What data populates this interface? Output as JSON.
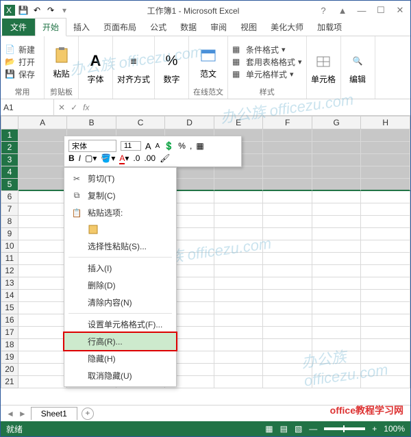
{
  "title": "工作簿1 - Microsoft Excel",
  "qat": {
    "save": "💾",
    "undo": "↶",
    "redo": "↷"
  },
  "winbtns": {
    "help": "?",
    "ribmin": "▲",
    "min": "—",
    "max": "☐",
    "close": "✕"
  },
  "tabs": {
    "file": "文件",
    "items": [
      "开始",
      "插入",
      "页面布局",
      "公式",
      "数据",
      "审阅",
      "视图",
      "美化大师",
      "加载项"
    ],
    "active_index": 0
  },
  "ribbon": {
    "group1": {
      "new": "新建",
      "open": "打开",
      "save": "保存",
      "label": "常用"
    },
    "clipboard": {
      "paste": "粘贴",
      "label": "剪贴板"
    },
    "font": {
      "btn": "字体",
      "label": ""
    },
    "align": {
      "btn": "对齐方式",
      "label": ""
    },
    "number": {
      "btn": "数字",
      "label": ""
    },
    "onlinefw": {
      "btn": "范文",
      "label": "在线范文"
    },
    "styles": {
      "cond": "条件格式",
      "tblfmt": "套用表格格式",
      "cellstyle": "单元格样式",
      "label": "样式"
    },
    "cells": {
      "btn": "单元格",
      "label": ""
    },
    "edit": {
      "btn": "编辑",
      "label": ""
    }
  },
  "namebox": "A1",
  "fx": "fx",
  "cols": [
    "A",
    "B",
    "C",
    "D",
    "E",
    "F",
    "G",
    "H"
  ],
  "rows": [
    "1",
    "2",
    "3",
    "4",
    "5",
    "6",
    "7",
    "8",
    "9",
    "10",
    "11",
    "12",
    "13",
    "14",
    "15",
    "16",
    "17",
    "18",
    "19",
    "20",
    "21"
  ],
  "minitb": {
    "font": "宋体",
    "size": "11",
    "bold": "B",
    "italic": "I",
    "inc": "A",
    "dec": "A",
    "curr": "%",
    "comma": ","
  },
  "context": [
    {
      "icon": "✂",
      "label": "剪切(T)"
    },
    {
      "icon": "⧉",
      "label": "复制(C)"
    },
    {
      "icon": "📋",
      "label": "粘贴选项:"
    },
    {
      "icon": "",
      "label": "",
      "pasteicon": true
    },
    {
      "icon": "",
      "label": "选择性粘贴(S)..."
    },
    {
      "sep": true
    },
    {
      "icon": "",
      "label": "插入(I)"
    },
    {
      "icon": "",
      "label": "删除(D)"
    },
    {
      "icon": "",
      "label": "清除内容(N)"
    },
    {
      "sep": true
    },
    {
      "icon": "",
      "label": "设置单元格格式(F)..."
    },
    {
      "icon": "",
      "label": "行高(R)...",
      "hover": true,
      "hl": true
    },
    {
      "icon": "",
      "label": "隐藏(H)"
    },
    {
      "icon": "",
      "label": "取消隐藏(U)"
    }
  ],
  "sheet": "Sheet1",
  "status": "就绪",
  "zoom": "100%",
  "credit": "office教程学习网",
  "watermark": "办公族 officezu.com"
}
